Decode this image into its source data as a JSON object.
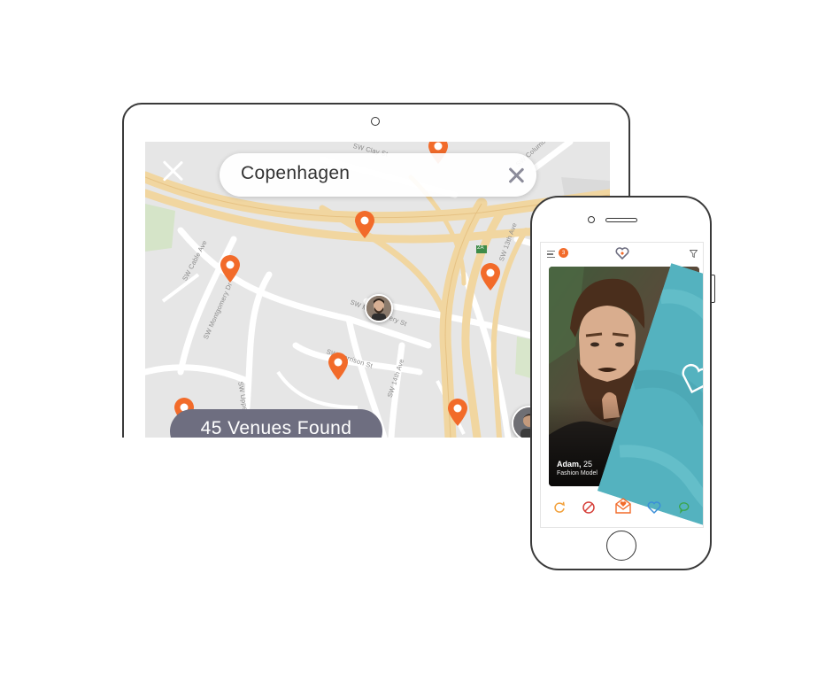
{
  "tablet": {
    "search": {
      "query": "Copenhagen"
    },
    "venues_found": "45 Venues Found",
    "streets": {
      "clay": "SW Clay St",
      "columbia": "SW Columbia St",
      "cable": "SW Cable Ave",
      "montgomery1": "SW Montgomery Dr",
      "montgomery2": "SW Montgomery St",
      "upper_hall": "SW Upper Hall St",
      "harrison": "SW Harrison St",
      "fourteenth": "SW 14th Ave",
      "thirteenth": "SW 13th Ave",
      "exit": "2A"
    },
    "colors": {
      "pin": "#f26b2a",
      "map_bg": "#e6e6e6",
      "highway": "#f2d9a6",
      "pill": "#6e6e80"
    }
  },
  "phone": {
    "notification_count": "3",
    "profile": {
      "name": "Adam,",
      "age": "25",
      "occupation": "Fashion Model"
    },
    "colors": {
      "accent": "#f26b2a",
      "swipe_card": "#54b2bf",
      "like": "#3b8fd8",
      "chat": "#3aa54a",
      "reject": "#d6403a"
    },
    "icons": [
      "menu-icon",
      "app-logo-icon",
      "filter-icon",
      "refresh-icon",
      "block-icon",
      "envelope-heart-icon",
      "heart-icon",
      "chat-icon"
    ]
  }
}
